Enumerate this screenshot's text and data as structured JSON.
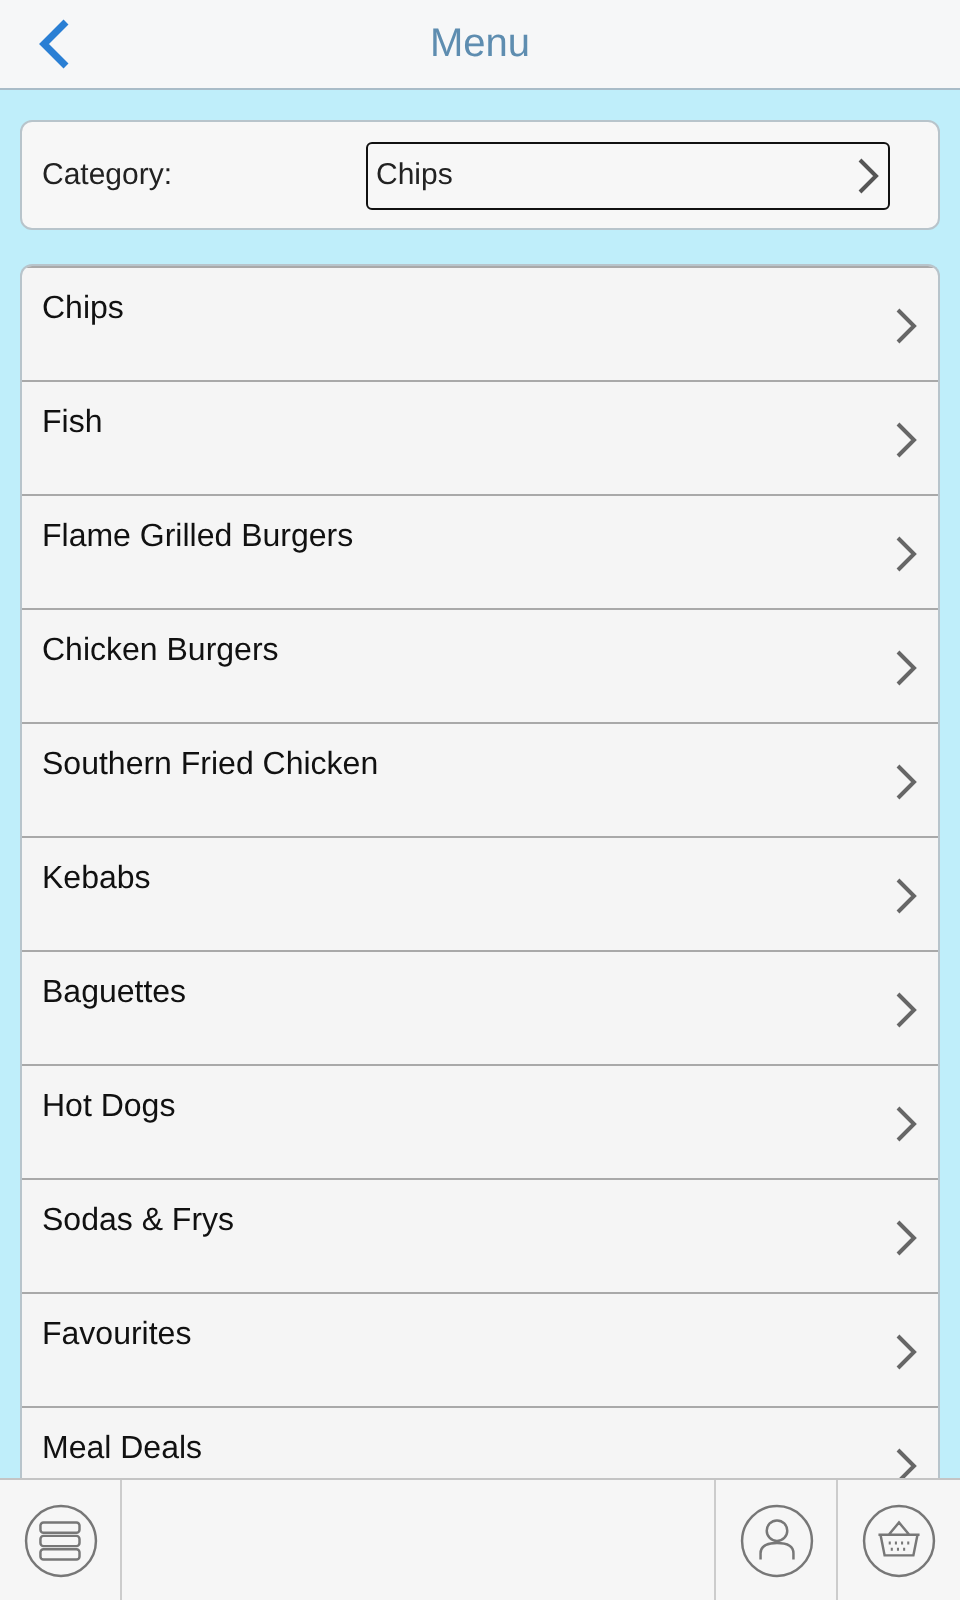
{
  "header": {
    "title": "Menu"
  },
  "category": {
    "label": "Category:",
    "value": "Chips"
  },
  "items": [
    {
      "label": "Chips"
    },
    {
      "label": "Fish"
    },
    {
      "label": "Flame Grilled Burgers"
    },
    {
      "label": "Chicken Burgers"
    },
    {
      "label": "Southern Fried Chicken"
    },
    {
      "label": "Kebabs"
    },
    {
      "label": "Baguettes"
    },
    {
      "label": "Hot Dogs"
    },
    {
      "label": "Sodas & Frys"
    },
    {
      "label": "Favourites"
    },
    {
      "label": "Meal Deals"
    }
  ]
}
